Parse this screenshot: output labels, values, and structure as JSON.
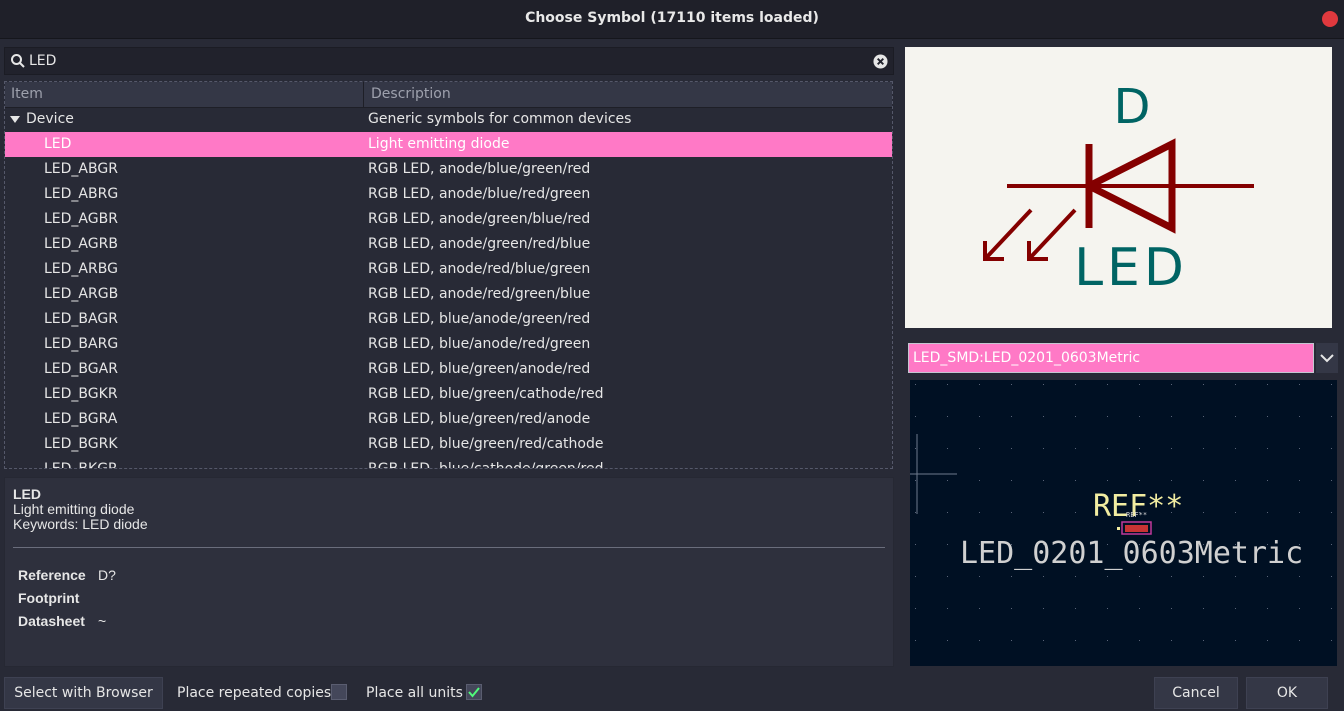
{
  "window": {
    "title": "Choose Symbol (17110 items loaded)"
  },
  "search": {
    "value": "LED"
  },
  "table": {
    "headers": {
      "item": "Item",
      "description": "Description"
    },
    "group": {
      "name": "Device",
      "description": "Generic symbols for common devices"
    },
    "rows": [
      {
        "name": "LED",
        "description": "Light emitting diode"
      },
      {
        "name": "LED_ABGR",
        "description": "RGB LED, anode/blue/green/red"
      },
      {
        "name": "LED_ABRG",
        "description": "RGB LED, anode/blue/red/green"
      },
      {
        "name": "LED_AGBR",
        "description": "RGB LED, anode/green/blue/red"
      },
      {
        "name": "LED_AGRB",
        "description": "RGB LED, anode/green/red/blue"
      },
      {
        "name": "LED_ARBG",
        "description": "RGB LED, anode/red/blue/green"
      },
      {
        "name": "LED_ARGB",
        "description": "RGB LED, anode/red/green/blue"
      },
      {
        "name": "LED_BAGR",
        "description": "RGB LED, blue/anode/green/red"
      },
      {
        "name": "LED_BARG",
        "description": "RGB LED, blue/anode/red/green"
      },
      {
        "name": "LED_BGAR",
        "description": "RGB LED, blue/green/anode/red"
      },
      {
        "name": "LED_BGKR",
        "description": "RGB LED, blue/green/cathode/red"
      },
      {
        "name": "LED_BGRA",
        "description": "RGB LED, blue/green/red/anode"
      },
      {
        "name": "LED_BGRK",
        "description": "RGB LED, blue/green/red/cathode"
      },
      {
        "name": "LED_BKGR",
        "description": "RGB LED, blue/cathode/green/red"
      }
    ],
    "selected_index": 0
  },
  "details": {
    "name": "LED",
    "description": "Light emitting diode",
    "keywords": "Keywords: LED diode",
    "reference_label": "Reference",
    "reference_value": "D?",
    "footprint_label": "Footprint",
    "footprint_value": "",
    "datasheet_label": "Datasheet",
    "datasheet_value": "~"
  },
  "symbol_preview": {
    "reference": "D",
    "value": "LED"
  },
  "footprint": {
    "selected": "LED_SMD:LED_0201_0603Metric",
    "preview_ref": "REF**",
    "preview_name": "LED_0201_0603Metric",
    "small_ref": "REF**"
  },
  "footer": {
    "browser_button": "Select with Browser",
    "repeated_label": "Place repeated copies",
    "repeated_checked": false,
    "all_units_label": "Place all units",
    "all_units_checked": true,
    "cancel_button": "Cancel",
    "ok_button": "OK"
  },
  "colors": {
    "selection": "#ff79c6",
    "symbol_body": "#840000",
    "symbol_text": "#006464",
    "fp_text": "#f2eda1",
    "fp_bg": "#001023",
    "checkbox_check": "#50fa7b"
  }
}
